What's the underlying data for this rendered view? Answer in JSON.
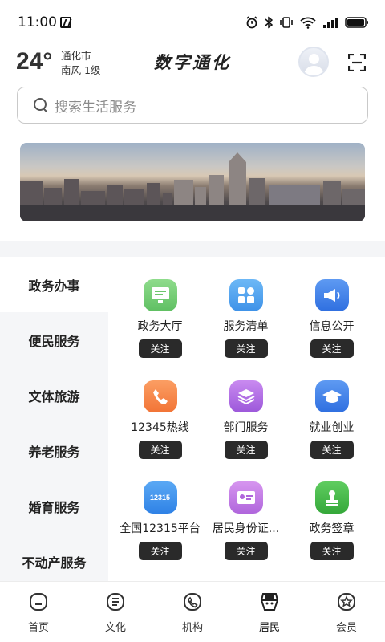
{
  "status_bar": {
    "time": "11:00"
  },
  "header": {
    "temperature": "24°",
    "city": "通化市",
    "wind": "南风 1级",
    "title": "数字通化"
  },
  "search": {
    "placeholder": "搜索生活服务"
  },
  "categories": [
    {
      "label": "政务办事",
      "active": true
    },
    {
      "label": "便民服务",
      "active": false
    },
    {
      "label": "文体旅游",
      "active": false
    },
    {
      "label": "养老服务",
      "active": false
    },
    {
      "label": "婚育服务",
      "active": false
    },
    {
      "label": "不动产服务",
      "active": false
    }
  ],
  "services": [
    {
      "label": "政务大厅",
      "icon": "monitor-icon",
      "color": "#7ccf7a",
      "follow": "关注"
    },
    {
      "label": "服务清单",
      "icon": "grid-list-icon",
      "color": "#4aa3f0",
      "follow": "关注"
    },
    {
      "label": "信息公开",
      "icon": "megaphone-icon",
      "color": "#3f7ee6",
      "follow": "关注"
    },
    {
      "label": "12345热线",
      "icon": "phone-icon",
      "color": "#f58a4a",
      "follow": "关注"
    },
    {
      "label": "部门服务",
      "icon": "layers-icon",
      "color": "#b06fe0",
      "follow": "关注"
    },
    {
      "label": "就业创业",
      "icon": "graduation-cap-icon",
      "color": "#3f7ee6",
      "follow": "关注"
    },
    {
      "label": "全国12315平台",
      "icon": "badge-12315-icon",
      "badge_text": "12315",
      "color": "#3f90ec",
      "follow": "关注"
    },
    {
      "label": "居民身份证...",
      "icon": "id-card-icon",
      "color": "#c77ee0",
      "follow": "关注"
    },
    {
      "label": "政务签章",
      "icon": "stamp-icon",
      "color": "#4cba4f",
      "follow": "关注"
    }
  ],
  "tabs": [
    {
      "label": "首页",
      "icon": "home-icon"
    },
    {
      "label": "文化",
      "icon": "culture-icon"
    },
    {
      "label": "机构",
      "icon": "institution-icon"
    },
    {
      "label": "居民",
      "icon": "resident-icon",
      "active": true
    },
    {
      "label": "会员",
      "icon": "member-icon"
    }
  ]
}
